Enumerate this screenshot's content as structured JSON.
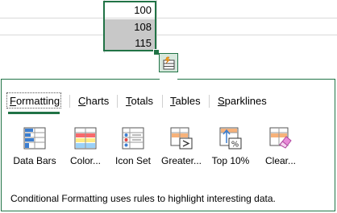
{
  "cells": [
    {
      "value": "100",
      "selected": false
    },
    {
      "value": "108",
      "selected": true
    },
    {
      "value": "115",
      "selected": true
    }
  ],
  "quick_analysis": {
    "icon": "quick-analysis-icon"
  },
  "tabs": [
    {
      "label_pre": "",
      "label_u": "F",
      "label_post": "ormatting",
      "active": true
    },
    {
      "label_pre": "",
      "label_u": "C",
      "label_post": "harts",
      "active": false
    },
    {
      "label_pre": "",
      "label_u": "T",
      "label_post": "otals",
      "active": false
    },
    {
      "label_pre": "",
      "label_u": "T",
      "label_post": "ables",
      "active": false
    },
    {
      "label_pre": "",
      "label_u": "S",
      "label_post": "parklines",
      "active": false
    }
  ],
  "items": [
    {
      "label": "Data Bars",
      "icon": "data-bars-icon"
    },
    {
      "label": "Color...",
      "icon": "color-scale-icon"
    },
    {
      "label": "Icon Set",
      "icon": "icon-set-icon"
    },
    {
      "label": "Greater...",
      "icon": "greater-than-icon"
    },
    {
      "label": "Top 10%",
      "icon": "top-ten-percent-icon"
    },
    {
      "label": "Clear...",
      "icon": "clear-format-icon"
    }
  ],
  "status": "Conditional Formatting uses rules to highlight interesting data.",
  "colors": {
    "accent": "#217346",
    "selection": "#c8c8c8"
  }
}
